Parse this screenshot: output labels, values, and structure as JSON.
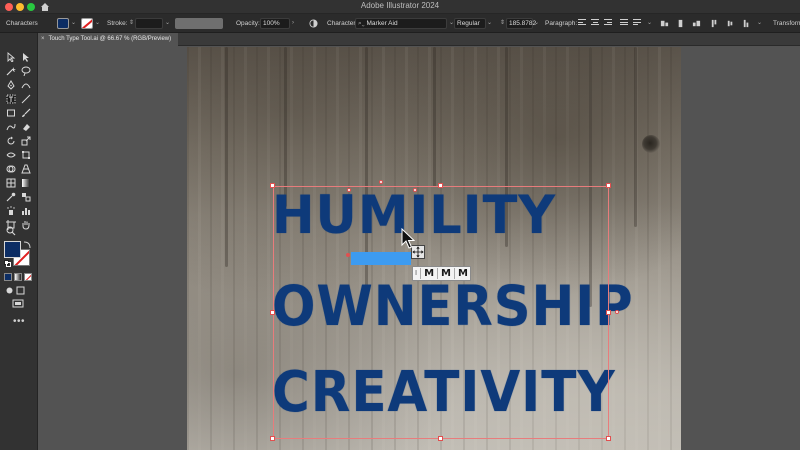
{
  "app": {
    "title": "Adobe Illustrator 2024",
    "window_controls": [
      "close",
      "minimize",
      "maximize"
    ]
  },
  "control_bar": {
    "panel_label": "Characters",
    "fill_color": "#0c2d64",
    "stroke_label": "Stroke:",
    "stroke_value": "",
    "opacity_label": "Opacity:",
    "opacity_value": "100%",
    "character_label": "Character:",
    "font_family": "Marker Aid",
    "font_style": "Regular",
    "font_size": "185.8782",
    "paragraph_label": "Paragraph:",
    "transform_label": "Transform"
  },
  "document": {
    "tab_close": "×",
    "tab_title": "Touch Type Tool.ai @ 66.67 % (RGB/Preview)"
  },
  "toolbar": {
    "fill_color": "#0c2d64",
    "stroke_color": "#ffffff",
    "more_label": "•••"
  },
  "artwork": {
    "text_color": "#0e3a7a",
    "lines": [
      "HUMILITY",
      "OWNERSHIP",
      "CREATIVITY"
    ]
  },
  "glyph_picker": {
    "glyphs": [
      "I",
      "M",
      "M",
      "M"
    ]
  }
}
